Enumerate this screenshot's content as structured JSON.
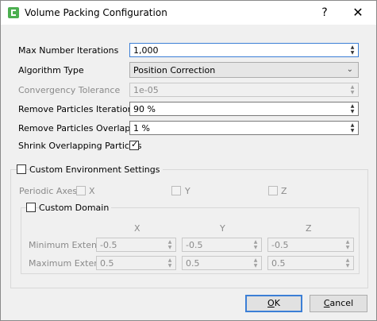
{
  "window": {
    "title": "Volume Packing Configuration",
    "help_glyph": "?",
    "close_glyph": "✕"
  },
  "fields": {
    "max_iterations": {
      "label": "Max Number Iterations",
      "value": "1,000"
    },
    "algorithm": {
      "label": "Algorithm Type",
      "value": "Position Correction"
    },
    "tolerance": {
      "label": "Convergency Tolerance",
      "value": "1e-05"
    },
    "remove_iter": {
      "label": "Remove Particles Iteration",
      "value": "90 %"
    },
    "remove_overlap": {
      "label": "Remove Particles Overlap",
      "value": "1 %"
    },
    "shrink": {
      "label": "Shrink Overlapping Particles",
      "checked": true
    }
  },
  "env": {
    "label": "Custom Environment Settings",
    "periodic_label": "Periodic Axes",
    "axis_x": "X",
    "axis_y": "Y",
    "axis_z": "Z",
    "domain_label": "Custom Domain",
    "col_x": "X",
    "col_y": "Y",
    "col_z": "Z",
    "min_label": "Minimum Extent",
    "max_label": "Maximum Extent",
    "min_x": "-0.5",
    "min_y": "-0.5",
    "min_z": "-0.5",
    "max_x": "0.5",
    "max_y": "0.5",
    "max_z": "0.5"
  },
  "buttons": {
    "ok_first": "O",
    "ok_rest": "K",
    "cancel_first": "C",
    "cancel_rest": "ancel"
  },
  "icons": {
    "app": "app-logo-icon",
    "check": "✓",
    "up": "▲",
    "down": "▼",
    "combo_arrow": "⌄"
  }
}
